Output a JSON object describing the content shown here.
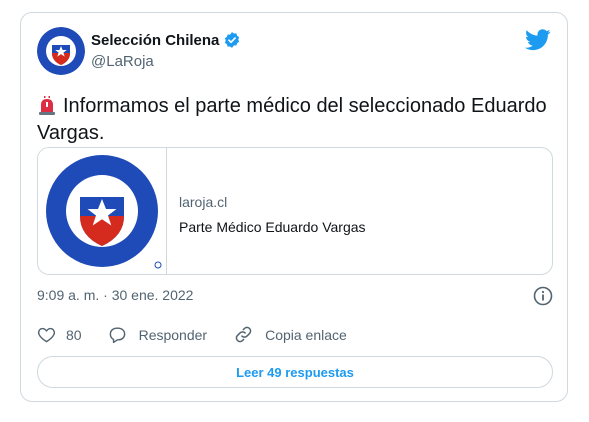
{
  "tweet": {
    "display_name": "Selección Chilena",
    "handle": "@LaRoja",
    "text": "Informamos el parte médico del seleccionado Eduardo Vargas.",
    "timestamp": "9:09 a. m. · 30 ene. 2022"
  },
  "card": {
    "domain": "laroja.cl",
    "title": "Parte Médico Eduardo Vargas"
  },
  "actions": {
    "like_count": "80",
    "reply_label": "Responder",
    "copy_link_label": "Copia enlace"
  },
  "replies_button": "Leer 49 respuestas",
  "colors": {
    "accent": "#1d9bf0",
    "secondary_text": "#536471",
    "border": "#cfd9de",
    "crest_blue": "#1f4bb8",
    "crest_red": "#d52b1e"
  },
  "icons": [
    "verified-badge-icon",
    "twitter-bird-icon",
    "siren-emoji-icon",
    "info-icon",
    "heart-icon",
    "reply-icon",
    "link-icon"
  ]
}
